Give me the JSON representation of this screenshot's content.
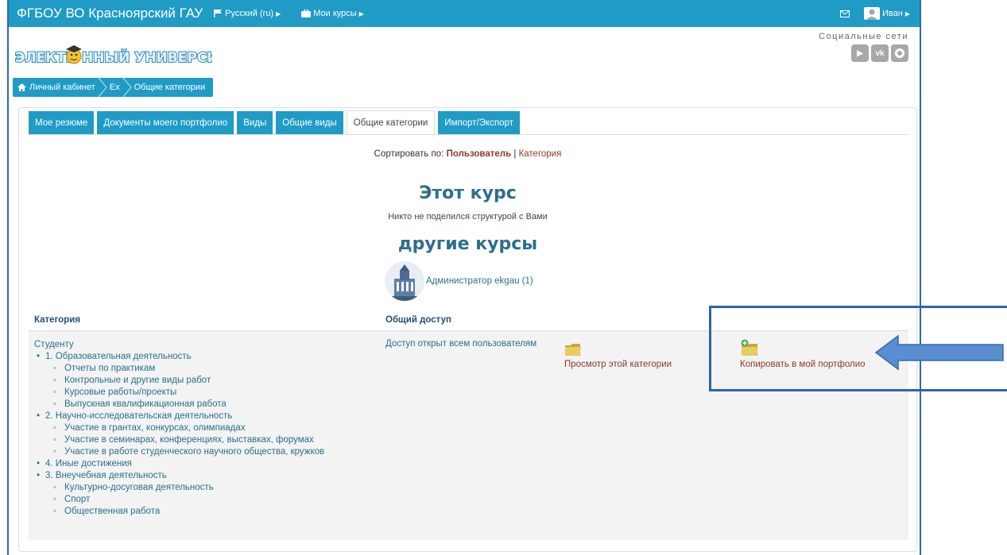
{
  "navbar": {
    "brand": "ФГБОУ ВО Красноярский ГАУ",
    "language": "Русский (ru)",
    "courses": "Мои курсы",
    "user": "Иван"
  },
  "header": {
    "social_title": "Социальные сети",
    "social_icons": [
      "youtube-icon",
      "vk-icon",
      "globe-icon"
    ],
    "logo_text": "ЭЛЕКТРОННЫЙ УНИВЕРСИТЕТ"
  },
  "breadcrumb": [
    "Личный кабинет",
    "Ex",
    "Общие категории"
  ],
  "tabs": [
    "Мое резюме",
    "Документы моего портфолио",
    "Виды",
    "Общие виды",
    "Общие категории",
    "Импорт/Экспорт"
  ],
  "active_tab": "Общие категории",
  "sort": {
    "prefix": "Сортировать по:",
    "active": "Пользователь",
    "separator": "|",
    "other": "Категория"
  },
  "this_course": {
    "title": "Этот курс",
    "message": "Никто не поделился структурой с Вами"
  },
  "other_courses": {
    "title": "другие курсы",
    "admin": "Администратор ekgau (1)"
  },
  "table": {
    "headers": [
      "Категория",
      "Общий доступ"
    ],
    "root": "Студенту",
    "categories": [
      {
        "label": "1. Образовательная деятельность",
        "children": [
          "Отчеты по практикам",
          "Контрольные и другие виды работ",
          "Курсовые работы/проекты",
          "Выпускная квалификационная работа"
        ]
      },
      {
        "label": "2. Научно-исследовательская деятельность",
        "children": [
          "Участие в грантах, конкурсах, олимпиадах",
          "Участие в семинарах, конференциях, выставках, форумах",
          "Участие в работе студенческого научного общества, кружков"
        ]
      },
      {
        "label": "4. Иные достижения",
        "children": []
      },
      {
        "label": "3. Внеучебная деятельность",
        "children": [
          "Культурно-досуговая деятельность",
          "Спорт",
          "Общественная работа"
        ]
      }
    ],
    "access": "Доступ открыт всем пользователям",
    "view_action": "Просмотр этой категории",
    "copy_action": "Копировать в мой портфолио"
  },
  "colors": {
    "primary": "#1f9bc6",
    "link": "#8b3a2a",
    "heading": "#2b6f8a",
    "highlight": "#2e64a8"
  }
}
